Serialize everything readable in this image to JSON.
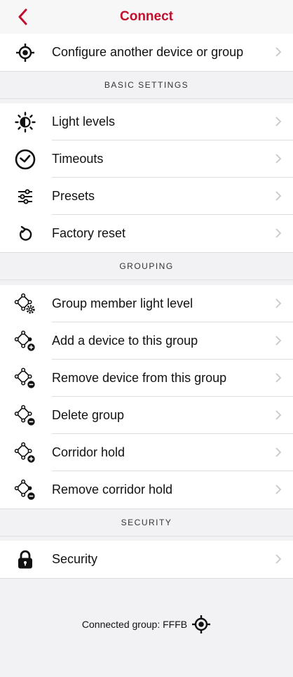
{
  "nav": {
    "title": "Connect"
  },
  "top_items": [
    {
      "label": "Configure another device or group",
      "icon": "target-icon"
    }
  ],
  "sections": {
    "basic": "BASIC SETTINGS",
    "grouping": "GROUPING",
    "security": "SECURITY"
  },
  "basic_items": [
    {
      "label": "Light levels",
      "icon": "brightness-icon"
    },
    {
      "label": "Timeouts",
      "icon": "clock-icon"
    },
    {
      "label": "Presets",
      "icon": "sliders-icon"
    },
    {
      "label": "Factory reset",
      "icon": "reset-icon"
    }
  ],
  "grouping_items": [
    {
      "label": "Group member light level",
      "icon": "group-gear-icon"
    },
    {
      "label": "Add a device to this group",
      "icon": "group-add-icon"
    },
    {
      "label": "Remove device from this group",
      "icon": "group-remove-icon"
    },
    {
      "label": "Delete group",
      "icon": "group-delete-icon"
    },
    {
      "label": "Corridor hold",
      "icon": "corridor-hold-icon"
    },
    {
      "label": "Remove corridor hold",
      "icon": "remove-corridor-hold-icon"
    }
  ],
  "security_items": [
    {
      "label": "Security",
      "icon": "lock-icon"
    }
  ],
  "footer": {
    "connected_label": "Connected group: FFFB"
  },
  "colors": {
    "accent": "#c2102c",
    "background": "#f2f2f4",
    "chevron": "#c7c7cc"
  }
}
